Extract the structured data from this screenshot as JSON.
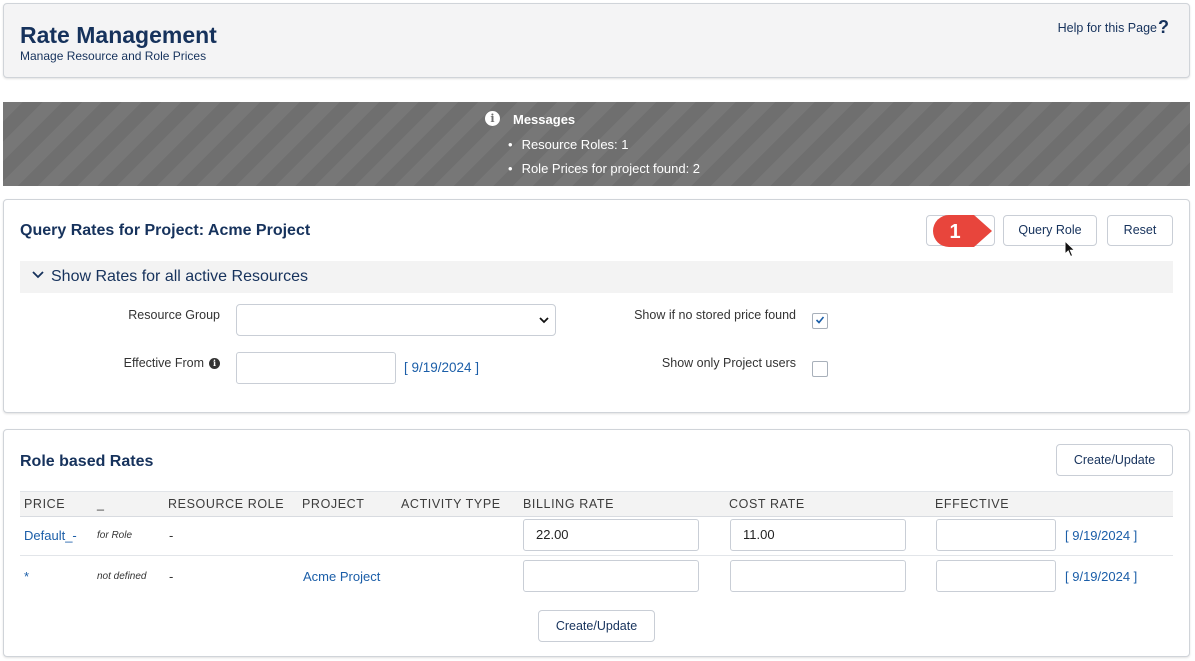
{
  "header": {
    "title": "Rate Management",
    "subtitle": "Manage Resource and Role Prices",
    "help_link": "Help for this Page",
    "help_icon": "?"
  },
  "messages": {
    "title": "Messages",
    "items": [
      "Resource Roles: 1",
      "Role Prices for project found: 2"
    ]
  },
  "query": {
    "title": "Query Rates for Project: Acme Project",
    "query_role_label": "Query Role",
    "reset_label": "Reset",
    "step_badge": "1",
    "section_title": "Show Rates for all active Resources",
    "resource_group_label": "Resource Group",
    "resource_group_value": "",
    "effective_from_label": "Effective From",
    "effective_from_value": "",
    "effective_from_default": "[ 9/19/2024 ]",
    "show_no_price_label": "Show if no stored price found",
    "show_no_price_checked": true,
    "show_project_users_label": "Show only Project users",
    "show_project_users_checked": false
  },
  "role_rates": {
    "title": "Role based Rates",
    "create_update_label": "Create/Update",
    "columns": [
      "PRICE",
      "_",
      "RESOURCE ROLE",
      "PROJECT",
      "ACTIVITY TYPE",
      "BILLING RATE",
      "COST RATE",
      "EFFECTIVE"
    ],
    "rows": [
      {
        "price": "Default_-",
        "type": "for Role",
        "resource_role": "-",
        "project": "",
        "activity_type": "",
        "billing_rate": "22.00",
        "cost_rate": "11.00",
        "effective": "",
        "effective_default": "[ 9/19/2024 ]"
      },
      {
        "price": "*",
        "type": "not defined",
        "resource_role": "-",
        "project": "Acme Project",
        "activity_type": "",
        "billing_rate": "",
        "cost_rate": "",
        "effective": "",
        "effective_default": "[ 9/19/2024 ]"
      }
    ],
    "create_update_bottom_label": "Create/Update"
  },
  "colors": {
    "title_navy": "#16325c",
    "link_blue": "#1b5ea8",
    "message_bg": "#6f6f6f",
    "badge_red": "#e8453c"
  }
}
